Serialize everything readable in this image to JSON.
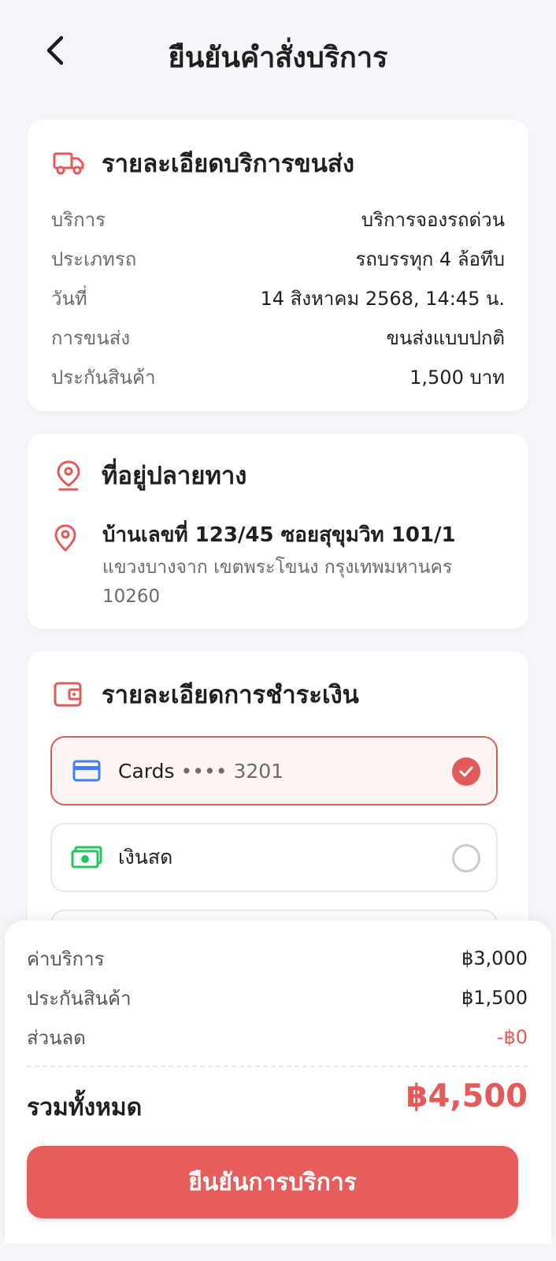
{
  "header": {
    "title": "ยืนยันคำสั่งบริการ"
  },
  "shipping": {
    "title": "รายละเอียดบริการขนส่ง",
    "rows": [
      {
        "label": "บริการ",
        "value": "บริการจองรถด่วน"
      },
      {
        "label": "ประเภทรถ",
        "value": "รถบรรทุก 4 ล้อทึบ"
      },
      {
        "label": "วันที่",
        "value": "14 สิงหาคม 2568, 14:45 น."
      },
      {
        "label": "การขนส่ง",
        "value": "ขนส่งแบบปกติ"
      },
      {
        "label": "ประกันสินค้า",
        "value": "1,500 บาท"
      }
    ]
  },
  "destination": {
    "title": "ที่อยู่ปลายทาง",
    "line1": "บ้านเลขที่ 123/45 ซอยสุขุมวิท 101/1",
    "line2": "แขวงบางจาก เขตพระโขนง กรุงเทพมหานคร 10260"
  },
  "payment": {
    "title": "รายละเอียดการชำระเงิน",
    "options": [
      {
        "label": "Cards",
        "mask": "•••• 3201",
        "selected": true,
        "icon": "credit-card-icon"
      },
      {
        "label": "เงินสด",
        "mask": "",
        "selected": false,
        "icon": "cash-icon"
      }
    ]
  },
  "summary": {
    "rows": [
      {
        "label": "ค่าบริการ",
        "value": "฿3,000"
      },
      {
        "label": "ประกันสินค้า",
        "value": "฿1,500"
      },
      {
        "label": "ส่วนลด",
        "value": "-฿0"
      }
    ],
    "total_label": "รวมทั้งหมด",
    "total_value": "฿4,500"
  },
  "confirm_label": "ยืนยันการบริการ",
  "colors": {
    "accent": "#e65d5d",
    "card_blue": "#3b82f6",
    "cash_green": "#22c55e"
  }
}
